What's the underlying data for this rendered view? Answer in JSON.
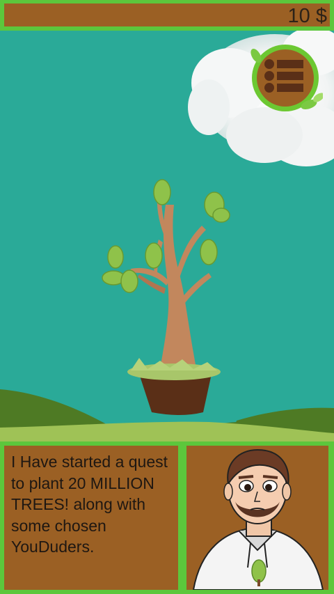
{
  "hud": {
    "money": "10 $"
  },
  "menu": {
    "icon": "list-menu-icon"
  },
  "dialog": {
    "text": "I Have started a quest to plant 20 MILLION TREES! along with some chosen YouDuders."
  },
  "portrait": {
    "icon": "character-portrait"
  },
  "colors": {
    "sky": "#2aaa98",
    "frame_green": "#5cc73c",
    "panel_brown": "#9b6024",
    "leaf": "#8fc24a",
    "trunk": "#c2875d"
  }
}
